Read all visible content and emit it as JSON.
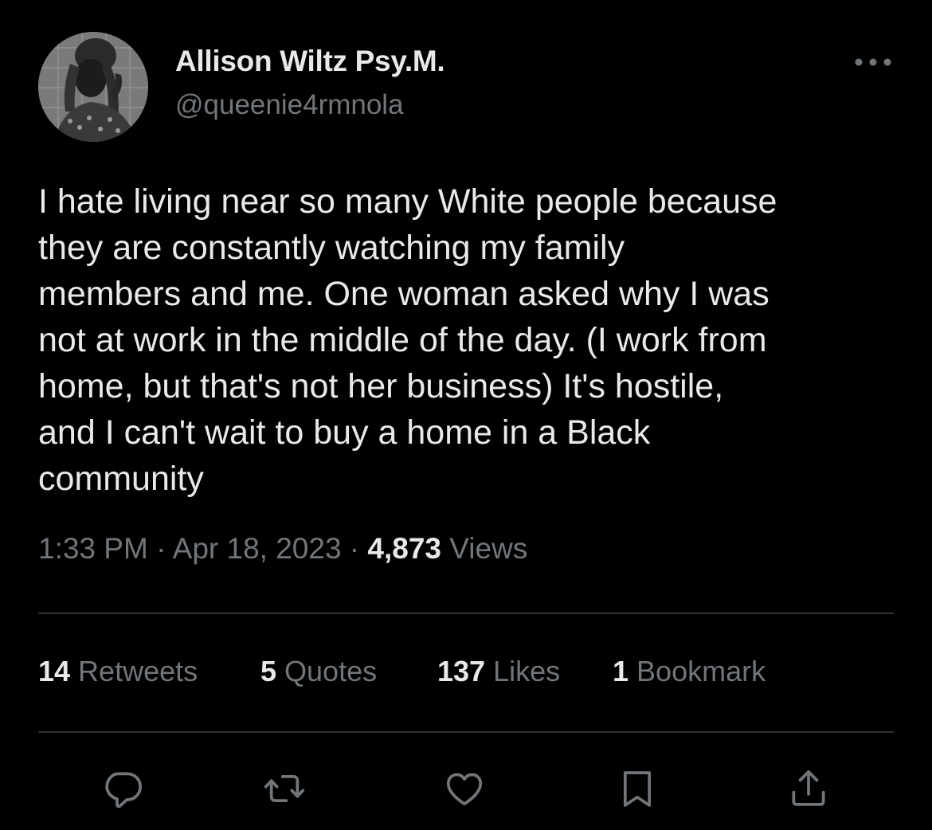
{
  "author": {
    "display_name": "Allison Wiltz Psy.M.",
    "handle": "@queenie4rmnola"
  },
  "tweet": {
    "text": "I hate living near so many White people because\nthey are constantly watching my family\nmembers and me. One woman asked why I was\nnot at work in the middle of the day. (I work from\nhome, but that's not her business) It's hostile,\nand I can't wait to buy a home in a Black\ncommunity"
  },
  "meta": {
    "time": "1:33 PM",
    "separator": " · ",
    "date": "Apr 18, 2023",
    "views_count": "4,873",
    "views_label": " Views"
  },
  "stats": {
    "retweets_count": "14",
    "retweets_label": " Retweets",
    "quotes_count": "5",
    "quotes_label": " Quotes",
    "likes_count": "137",
    "likes_label": " Likes",
    "bookmarks_count": "1",
    "bookmarks_label": " Bookmark"
  },
  "icons": {
    "more": "more-icon",
    "reply": "reply-icon",
    "retweet": "retweet-icon",
    "like": "heart-icon",
    "bookmark": "bookmark-icon",
    "share": "share-icon"
  },
  "colors": {
    "background": "#000000",
    "primary_text": "#e7e9ea",
    "secondary_text": "#71767b",
    "divider": "#2f3336"
  }
}
